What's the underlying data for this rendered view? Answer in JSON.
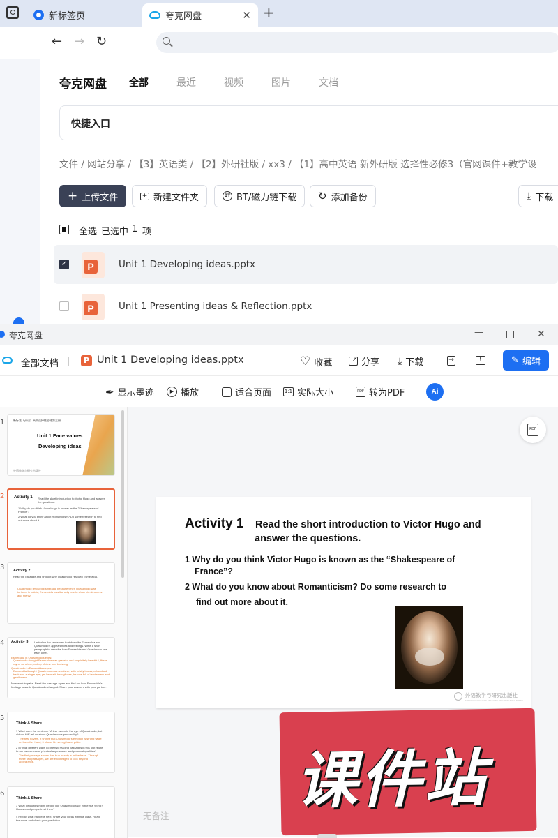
{
  "browser": {
    "tabs": [
      {
        "label": "新标签页"
      },
      {
        "label": "夸克网盘"
      }
    ],
    "new_tab_icon": "+"
  },
  "drive": {
    "brand": "夸克网盘",
    "nav": [
      "全部",
      "最近",
      "视频",
      "图片",
      "文档"
    ],
    "quick_entry": "快捷入口",
    "breadcrumb": [
      "文件",
      "网站分享",
      "【3】英语类",
      "【2】外研社版",
      "xx3",
      "【1】高中英语 新外研版 选择性必修3（官网课件+教学设"
    ],
    "actions": {
      "upload": "上传文件",
      "new_folder": "新建文件夹",
      "bt": "BT/磁力链下载",
      "backup": "添加备份",
      "download": "下载"
    },
    "selection": {
      "select_all": "全选",
      "selected": "已选中",
      "count": "1",
      "unit": "项"
    },
    "files": [
      {
        "name": "Unit 1 Developing ideas.pptx",
        "checked": true
      },
      {
        "name": "Unit 1 Presenting ideas & Reflection.pptx",
        "checked": false
      }
    ]
  },
  "viewer": {
    "window_title": "夸克网盘",
    "all_docs": "全部文档",
    "file_name": "Unit 1 Developing ideas.pptx",
    "actions": {
      "favorite": "收藏",
      "share": "分享",
      "download": "下载",
      "edit": "编辑"
    },
    "toolbar": {
      "ink": "显示墨迹",
      "play": "播放",
      "fit": "适合页面",
      "actual": "实际大小",
      "to_pdf": "转为PDF",
      "ai": "Ai"
    },
    "notes": "无备注",
    "accent": "#1d6ff2",
    "thumbnails": [
      {
        "num": "1",
        "header": "新标准《英语》高中选择性必修第三册",
        "title1": "Unit 1 Face values",
        "title2": "Developing ideas",
        "footer": "外语教学与研究出版社"
      },
      {
        "num": "2",
        "title": "Activity 1",
        "text": "Read the short introduction to Victor Hugo and answer the questions.",
        "q1": "1 Why do you think Victor Hugo is known as the \"Shakespeare of France\"?",
        "q2": "2 What do you know about Romanticism? Do some research to find out more about it."
      },
      {
        "num": "3",
        "title": "Activity 2",
        "text": "Read the passage and find out why Quasimodo rescued Esmeralda.",
        "orange": "Quasimodo rescued Esmeralda because when Quasimodo was tortured in public, Esmeralda was the only one to show him kindness and mercy."
      },
      {
        "num": "4",
        "title": "Activity 3",
        "text": "Underline the sentences that describe Esmeralda and Quasimodo's appearances and feelings. Write a short paragraph to describe how Esmeralda and Quasimodo see each other.",
        "l1": "Esmeralda in Quasimodo's eyes:",
        "l2": "Quasimodo thought Esmeralda was graceful and exquisitely beautiful, like a ray of sunshine, a drop of dew or a birdsong.",
        "l3": "Quasimodo in Esmeralda's eyes:",
        "l4": "Esmeralda thought Quasimodo was repulsive, with bristly brows, a hunched back and a single eye; yet beneath his ugliness, he was full of tenderness and gentleness.",
        "l5": "Now work in pairs. Read the passage again and find out how Esmeralda's feelings towards Quasimodo changed. Share your answers with your partner."
      },
      {
        "num": "5",
        "title": "Think & Share",
        "l1": "1 What does the sentence \"A tear swam in the eye of Quasimodo, but did not fall\" tell us about Quasimodo's personality?",
        "l2": "The tear hovers, it shows that Quasimodo's emotion is strong while on the other hand, it shows his strength and pride.",
        "l3": "2 In what different ways do the two reading passages in this unit relate to our awareness of physical appearance and personal qualities?",
        "l4": "The first passage shows that true beauty is in the heart. Through these two passages, we are encouraged to look beyond appearance."
      },
      {
        "num": "6",
        "title": "Think & Share",
        "l1": "3 What difficulties might people like Quasimodo face in the real world? How should people treat them?",
        "l2": "4 Predict what happens next. Share your ideas with the class. Read the novel and check your prediction."
      }
    ],
    "slide": {
      "activity": "Activity 1",
      "instruction1": "Read the short introduction to Victor Hugo and",
      "instruction2": "answer the questions.",
      "q1a": "1 Why do you think Victor Hugo is known as the “Shakespeare of",
      "q1b": "France”?",
      "q2a": "2 What do you know about Romanticism? Do some research to",
      "q2b": "find out more about it.",
      "publisher": "外语教学与研究出版社",
      "publisher_en": "FOREIGN LANGUAGE TEACHING AND RESEARCH PRESS"
    },
    "watermark": "课件站"
  }
}
